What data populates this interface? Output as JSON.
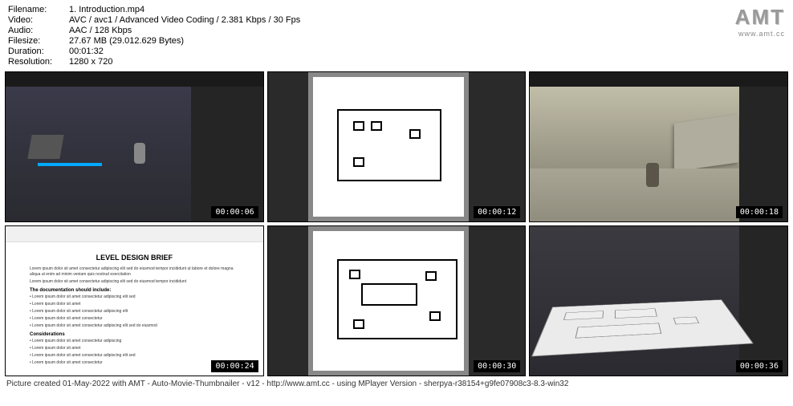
{
  "meta": {
    "filename_label": "Filename:",
    "filename_value": "1. Introduction.mp4",
    "video_label": "Video:",
    "video_value": "AVC / avc1 / Advanced Video Coding / 2.381 Kbps / 30 Fps",
    "audio_label": "Audio:",
    "audio_value": "AAC / 128 Kbps",
    "filesize_label": "Filesize:",
    "filesize_value": "27.67 MB (29.012.629 Bytes)",
    "duration_label": "Duration:",
    "duration_value": "00:01:32",
    "resolution_label": "Resolution:",
    "resolution_value": "1280 x 720"
  },
  "logo": {
    "text": "AMT",
    "url": "www.amt.cc"
  },
  "thumbnails": [
    {
      "timestamp": "00:00:06"
    },
    {
      "timestamp": "00:00:12"
    },
    {
      "timestamp": "00:00:18"
    },
    {
      "timestamp": "00:00:24"
    },
    {
      "timestamp": "00:00:30"
    },
    {
      "timestamp": "00:00:36"
    }
  ],
  "document": {
    "title": "LEVEL DESIGN BRIEF",
    "heading1": "The documentation should include:",
    "heading2": "Considerations"
  },
  "footer": "Picture created 01-May-2022 with AMT - Auto-Movie-Thumbnailer - v12 - http://www.amt.cc - using MPlayer Version - sherpya-r38154+g9fe07908c3-8.3-win32"
}
